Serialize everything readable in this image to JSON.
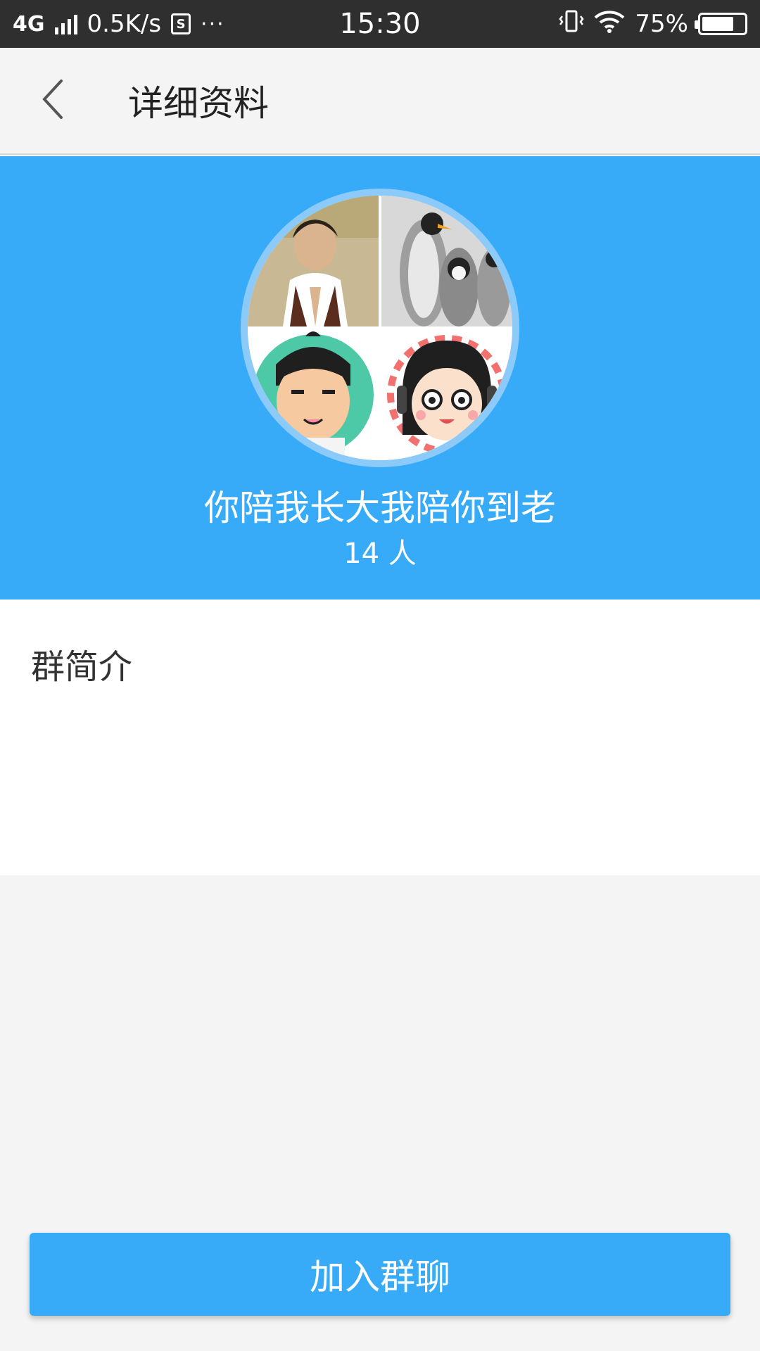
{
  "status_bar": {
    "network_type": "4G",
    "speed": "0.5K/s",
    "more": "···",
    "time": "15:30",
    "battery": "75%",
    "battery_level": 0.75
  },
  "header": {
    "title": "详细资料",
    "back_icon": "chevron-left-icon"
  },
  "group": {
    "name": "你陪我长大我陪你到老",
    "member_count": "14 人",
    "avatar_tiles": [
      "member-photo-1",
      "penguins-photo",
      "cartoon-boy",
      "cartoon-girl-headphones"
    ]
  },
  "intro": {
    "label": "群简介"
  },
  "actions": {
    "join_label": "加入群聊"
  },
  "colors": {
    "accent": "#37abf8",
    "status_bar": "#2f2f2f",
    "background": "#f4f4f4"
  }
}
